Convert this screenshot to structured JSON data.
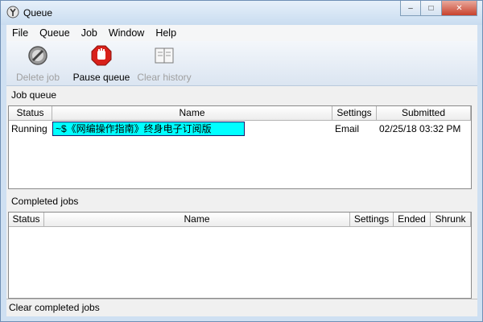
{
  "window": {
    "title": "Queue",
    "controls": {
      "minimize": "–",
      "maximize": "□",
      "close": "✕"
    }
  },
  "menu": [
    "File",
    "Queue",
    "Job",
    "Window",
    "Help"
  ],
  "toolbar": {
    "delete_job": {
      "label": "Delete job",
      "icon": "delete-job-icon",
      "enabled": false
    },
    "pause_queue": {
      "label": "Pause queue",
      "icon": "pause-queue-icon",
      "enabled": true
    },
    "clear_history": {
      "label": "Clear history",
      "icon": "clear-history-icon",
      "enabled": false
    }
  },
  "job_queue": {
    "title": "Job queue",
    "columns": [
      "Status",
      "Name",
      "Settings",
      "Submitted"
    ],
    "rows": [
      {
        "status": "Running",
        "name": "~$《网编操作指南》终身电子订阅版",
        "settings": "Email",
        "submitted": "02/25/18 03:32 PM"
      }
    ]
  },
  "completed_jobs": {
    "title": "Completed jobs",
    "columns": [
      "Status",
      "Name",
      "Settings",
      "Ended",
      "Shrunk"
    ],
    "rows": []
  },
  "status_bar": {
    "text": "Clear completed jobs"
  },
  "colors": {
    "selected_cell": "#00ffff",
    "disabled_text": "#a0a0a0",
    "pause_icon": "#d8201a"
  }
}
